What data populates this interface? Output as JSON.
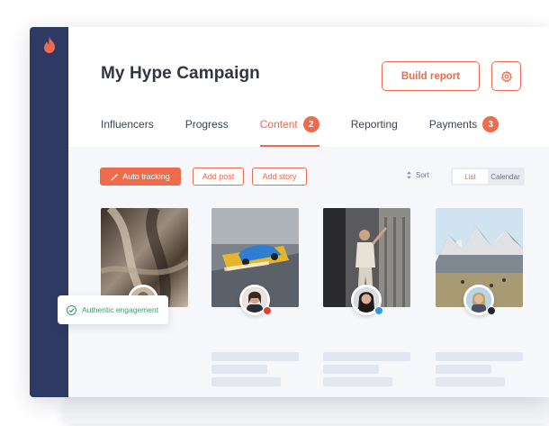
{
  "campaign": {
    "title": "My Hype Campaign",
    "build_report_label": "Build report"
  },
  "tabs": [
    {
      "label": "Influencers",
      "badge": null
    },
    {
      "label": "Progress",
      "badge": null
    },
    {
      "label": "Content",
      "badge": "2",
      "active": true
    },
    {
      "label": "Reporting",
      "badge": null
    },
    {
      "label": "Payments",
      "badge": "3"
    }
  ],
  "toolbar": {
    "auto_tracking_label": "Auto tracking",
    "add_post_label": "Add post",
    "add_story_label": "Add story",
    "sort_label": "Sort",
    "view_options": [
      "List",
      "Calendar"
    ],
    "selected_view": "List"
  },
  "posts": [
    {
      "network": "instagram",
      "network_color": "#ee6b4d"
    },
    {
      "network": "youtube",
      "network_color": "#e0412f"
    },
    {
      "network": "twitter",
      "network_color": "#2d9bd8"
    },
    {
      "network": "tiktok",
      "network_color": "#1f2430"
    }
  ],
  "engagement_badge": {
    "label": "Authentic engagement"
  },
  "colors": {
    "accent": "#ee6b4d",
    "sidebar": "#2e3a64",
    "success": "#3c9b6b"
  }
}
